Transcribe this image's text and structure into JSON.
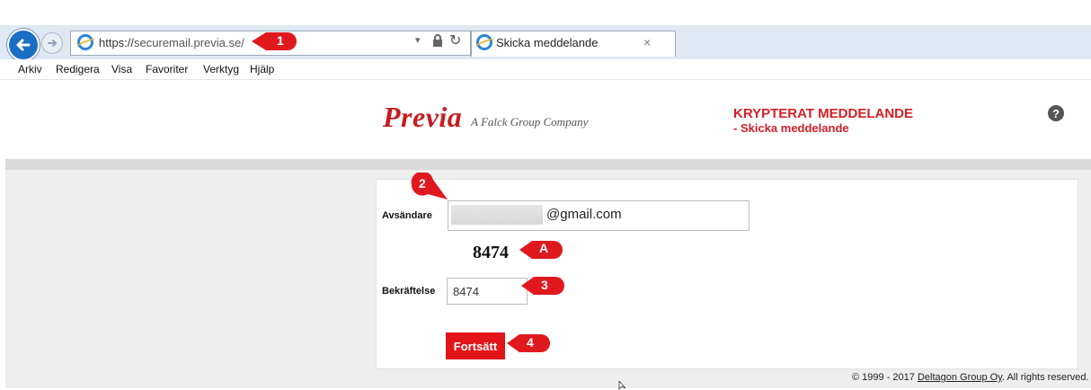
{
  "browser": {
    "url_prefix": "https://",
    "url_host": "securemail.previa.se/",
    "tab_title": "Skicka meddelande",
    "tab_close": "×",
    "menu": [
      "Arkiv",
      "Redigera",
      "Visa",
      "Favoriter",
      "Verktyg",
      "Hjälp"
    ]
  },
  "header": {
    "logo": "Previa",
    "logo_sub": "A Falck Group Company",
    "title": "KRYPTERAT MEDDELANDE",
    "subtitle": "- Skicka meddelande",
    "help": "?"
  },
  "form": {
    "sender_label": "Avsändare",
    "sender_domain": "@gmail.com",
    "captcha_code": "8474",
    "confirm_label": "Bekräftelse",
    "confirm_value": "8474",
    "submit_label": "Fortsätt"
  },
  "footer": {
    "prefix": "© 1999 - 2017",
    "company": "Deltagon Group Oy",
    "suffix": "All rights reserved."
  },
  "callouts": [
    "1",
    "2",
    "A",
    "3",
    "4"
  ],
  "colors": {
    "brand_red": "#c41e24",
    "button_red": "#e3151b",
    "callout_red": "#e0191f"
  }
}
